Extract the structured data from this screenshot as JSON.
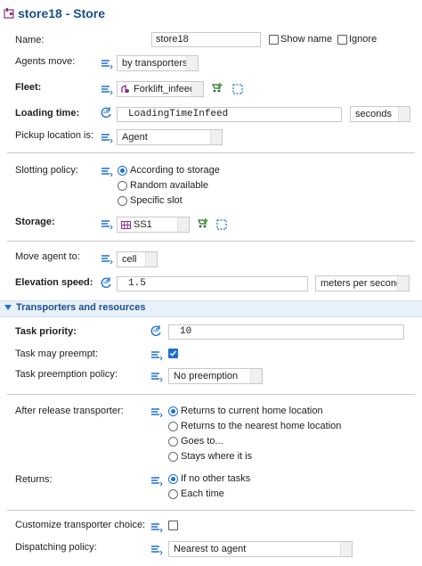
{
  "title": "store18 - Store",
  "name": {
    "label": "Name:",
    "value": "store18",
    "show_name": "Show name",
    "ignore": "Ignore"
  },
  "agents_move": {
    "label": "Agents move:",
    "value": "by transporters"
  },
  "fleet": {
    "label": "Fleet:",
    "value": "Forklift_infeed"
  },
  "loading_time": {
    "label": "Loading time:",
    "value": "LoadingTimeInfeed",
    "unit": "seconds"
  },
  "pickup": {
    "label": "Pickup location is:",
    "value": "Agent"
  },
  "slotting": {
    "label": "Slotting policy:",
    "options": [
      "According to storage",
      "Random available",
      "Specific slot"
    ],
    "selected": 0
  },
  "storage": {
    "label": "Storage:",
    "value": "SS1"
  },
  "move_agent_to": {
    "label": "Move agent to:",
    "value": "cell"
  },
  "elevation_speed": {
    "label": "Elevation speed:",
    "value": "1.5",
    "unit": "meters per second"
  },
  "section": {
    "title": "Transporters and resources"
  },
  "task_priority": {
    "label": "Task priority:",
    "value": "10"
  },
  "task_preempt": {
    "label": "Task may preempt:",
    "checked": true
  },
  "task_preemption_policy": {
    "label": "Task preemption policy:",
    "value": "No preemption"
  },
  "after_release": {
    "label": "After release transporter:",
    "options": [
      "Returns to current home location",
      "Returns to the nearest home location",
      "Goes to...",
      "Stays where it is"
    ],
    "selected": 0
  },
  "returns": {
    "label": "Returns:",
    "options": [
      "If no other tasks",
      "Each time"
    ],
    "selected": 0
  },
  "customize_choice": {
    "label": "Customize transporter choice:",
    "checked": false
  },
  "dispatching": {
    "label": "Dispatching policy:",
    "value": "Nearest to agent"
  },
  "colors": {
    "title": "#1a4f8b",
    "accent": "#1e6fd0",
    "section_bg": "#e8f0fa"
  }
}
